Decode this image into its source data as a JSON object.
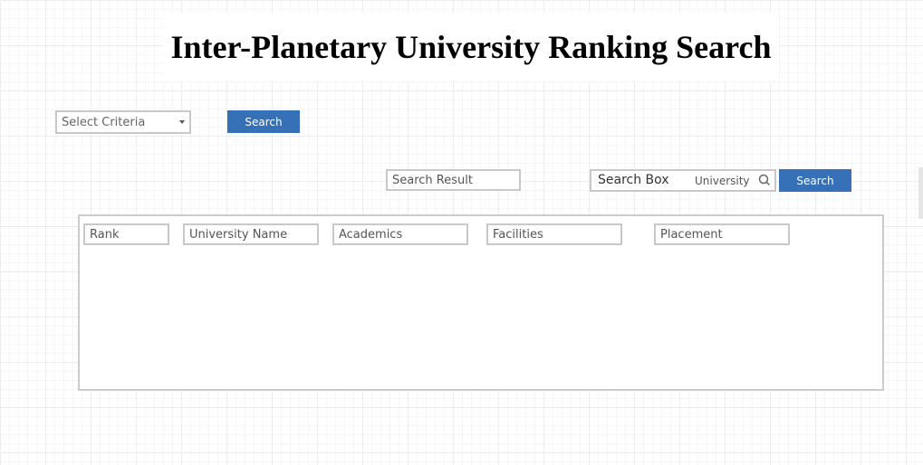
{
  "page": {
    "title": "Inter-Planetary University Ranking Search"
  },
  "criteria": {
    "select_label": "Select Criteria",
    "search_button": "Search"
  },
  "result_section": {
    "result_label": "Search Result",
    "search_box_label": "Search Box",
    "search_box_value": "University",
    "search_icon": "search-icon",
    "search_button": "Search"
  },
  "table": {
    "columns": [
      "Rank",
      "University Name",
      "Academics",
      "Facilities",
      "Placement"
    ],
    "rows": []
  },
  "colors": {
    "accent": "#3670b6",
    "border": "#c8c8c8"
  }
}
